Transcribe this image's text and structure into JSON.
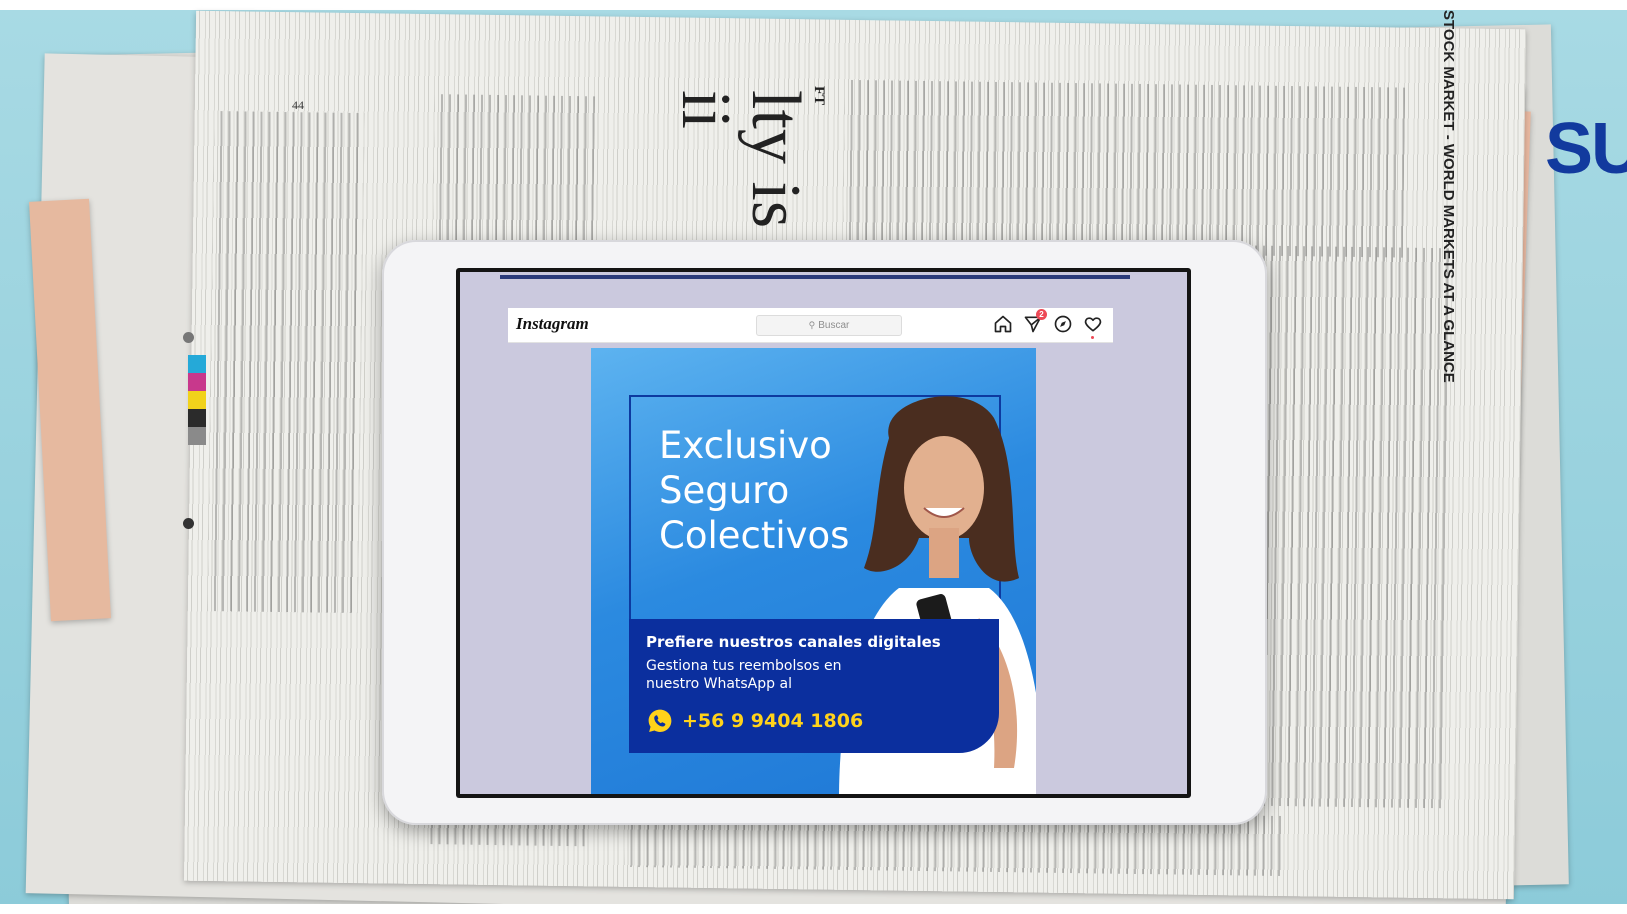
{
  "brand": {
    "text": "SU",
    "color": "#123a9e"
  },
  "newspaper": {
    "headline_fragment": "lty is ii",
    "side_header": "STOCK MARKET - WORLD MARKETS AT A GLANCE",
    "ft_mark": "FT",
    "page_number": "44"
  },
  "instagram": {
    "logo": "Instagram",
    "search_placeholder": "Buscar",
    "notification_count": "2",
    "icons": [
      "home-icon",
      "direct-icon",
      "explore-icon",
      "heart-icon"
    ]
  },
  "post": {
    "headline_lines": [
      "Exclusivo",
      "Seguro",
      "Colectivos"
    ],
    "cta_title": "Prefiere nuestros canales digitales",
    "cta_body": "Gestiona tus reembolsos en nuestro WhatsApp al",
    "phone": "+56 9 9404 1806",
    "colors": {
      "dark_blue": "#0b2f9e",
      "phone_yellow": "#ffd21a",
      "bg_blue": "#2b8ae0"
    }
  }
}
